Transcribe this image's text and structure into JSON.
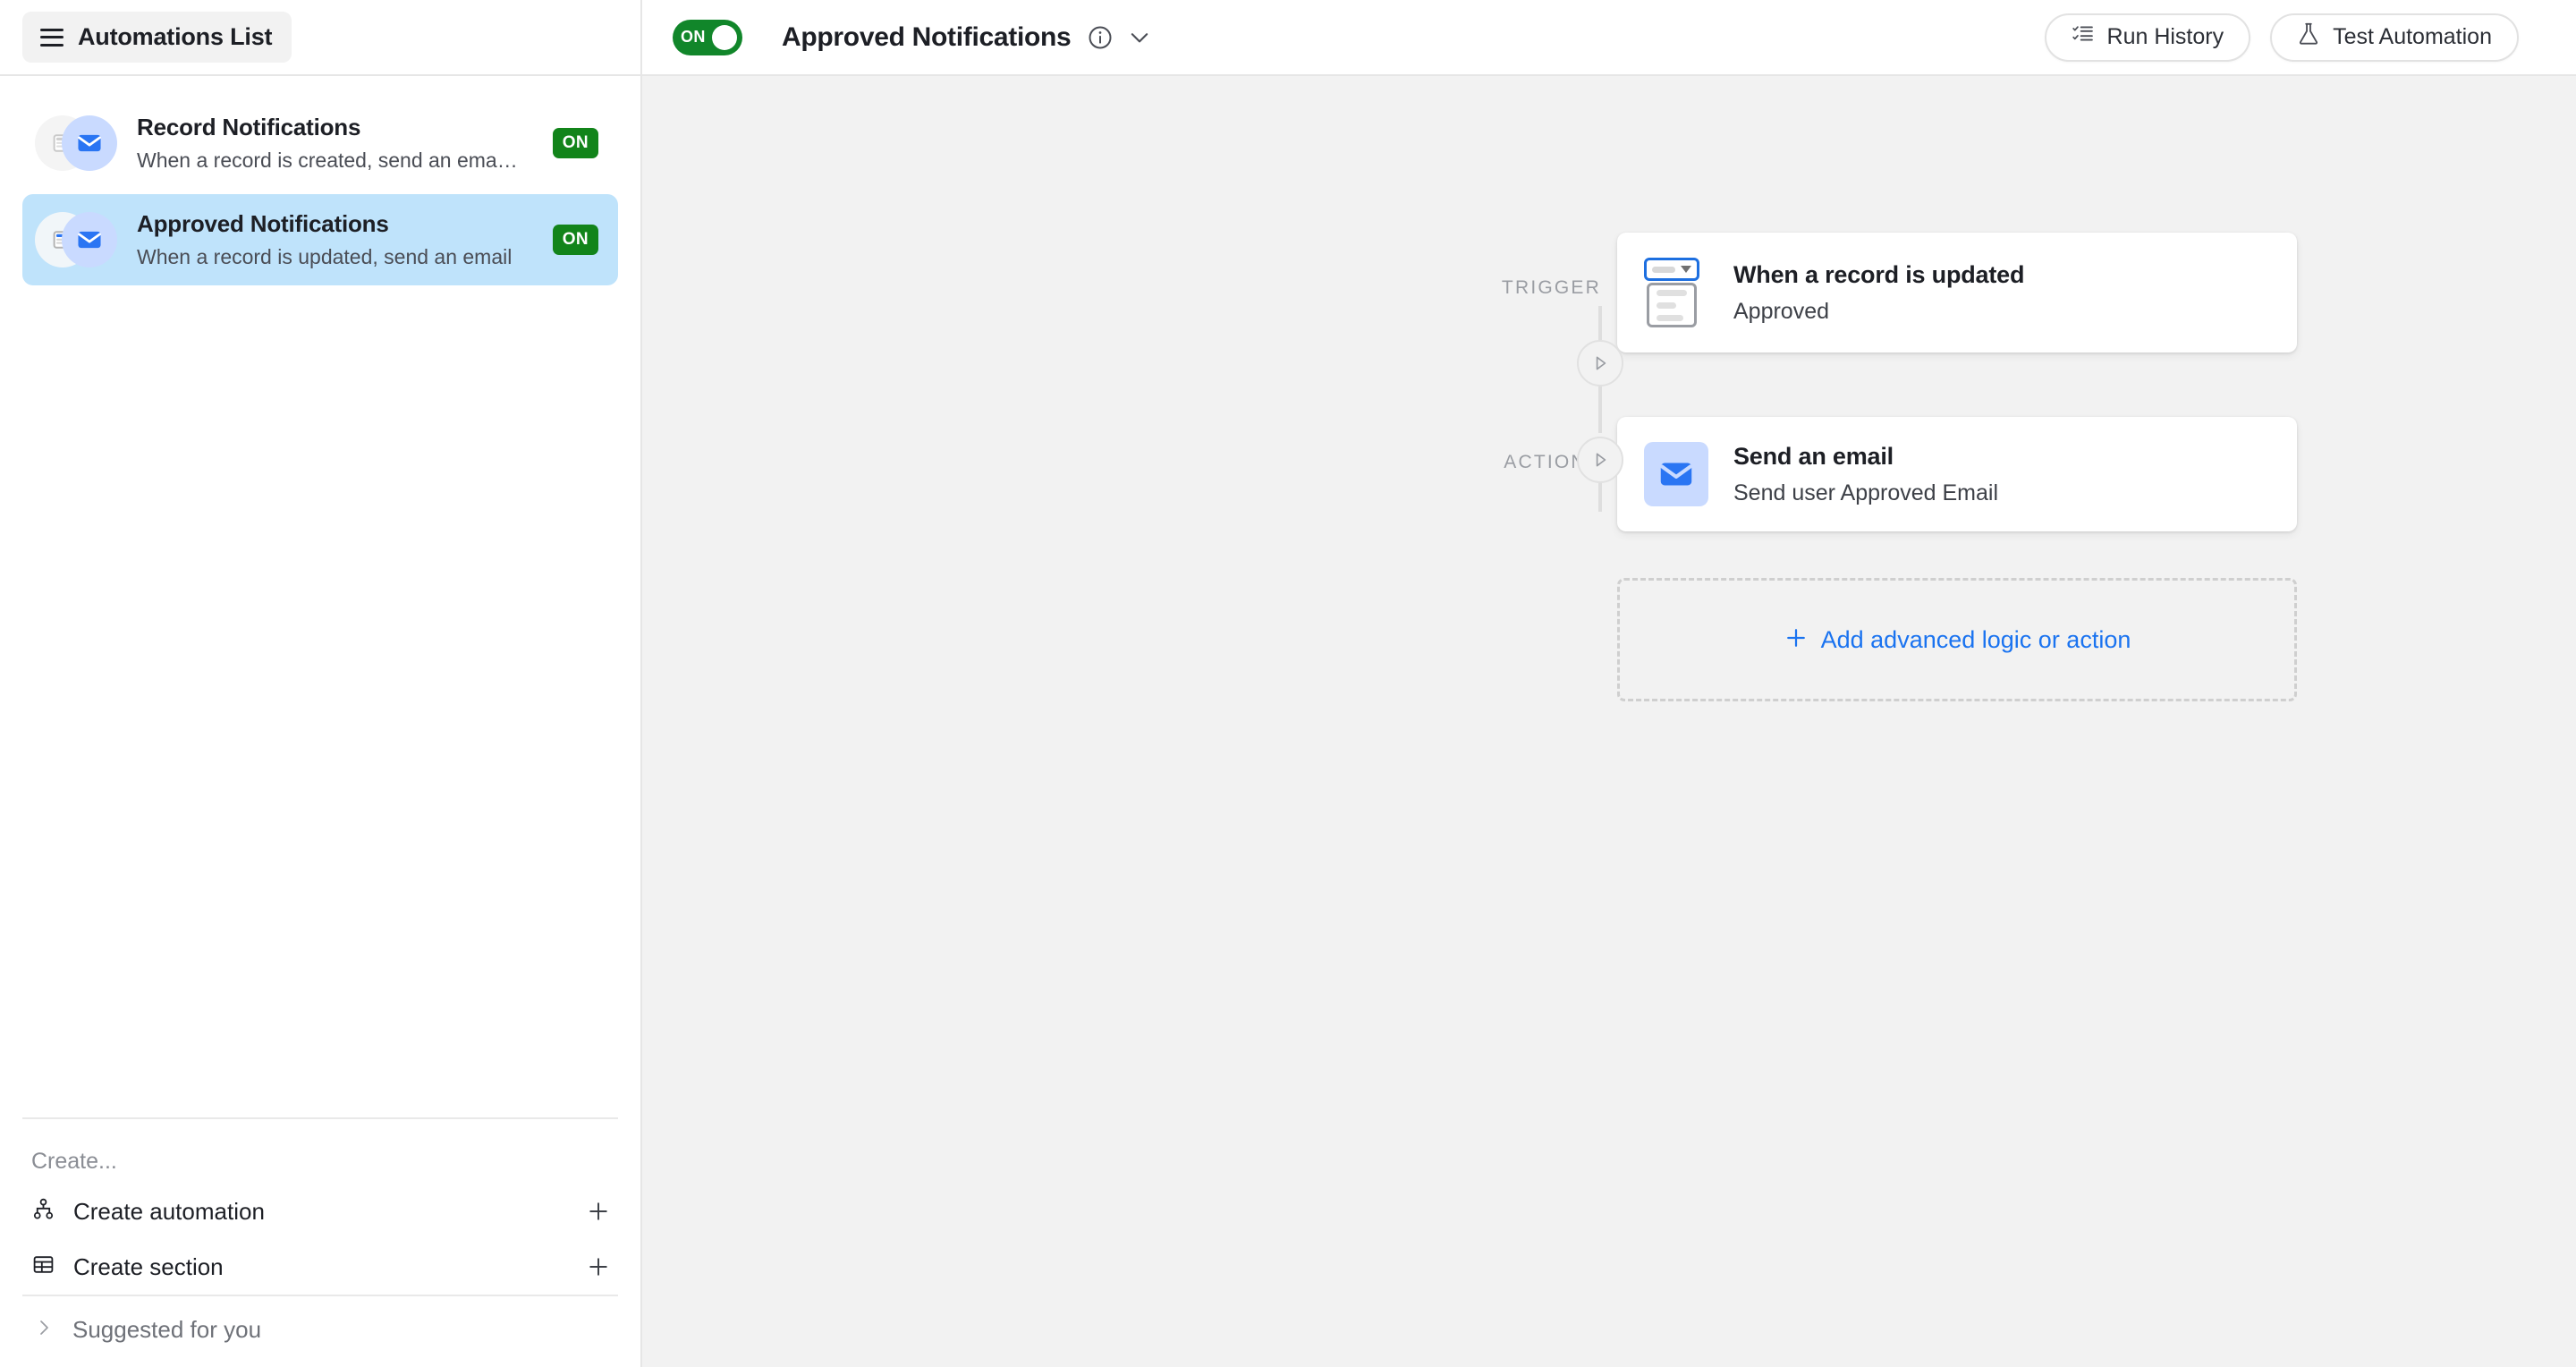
{
  "topbar": {
    "menu_button_label": "Automations List",
    "menu_icon": "hamburger-icon",
    "toggle": {
      "state_label": "ON",
      "on_color": "#11862a"
    },
    "automation_title": "Approved Notifications",
    "info_icon": "info-circle-icon",
    "chevron_icon": "chevron-down-icon",
    "run_history_label": "Run History",
    "run_history_icon": "checklist-icon",
    "test_automation_label": "Test Automation",
    "test_automation_icon": "flask-icon"
  },
  "sidebar": {
    "automations": [
      {
        "name": "Record Notifications",
        "description": "When a record is created, send an ema…",
        "status": "ON",
        "selected": false,
        "icons": [
          "record-icon",
          "email-icon"
        ]
      },
      {
        "name": "Approved Notifications",
        "description": "When a record is updated, send an email",
        "status": "ON",
        "selected": true,
        "icons": [
          "record-icon",
          "email-icon"
        ]
      }
    ],
    "create_section_label": "Create...",
    "create_rows": [
      {
        "label": "Create automation",
        "icon": "sitemap-icon",
        "action_icon": "plus-icon"
      },
      {
        "label": "Create section",
        "icon": "table-icon",
        "action_icon": "plus-icon"
      }
    ],
    "suggested_label": "Suggested for you",
    "suggested_icon": "chevron-right-icon"
  },
  "canvas": {
    "rail_labels": {
      "trigger": "TRIGGER",
      "actions": "ACTIONS"
    },
    "trigger_card": {
      "title": "When a record is updated",
      "subtitle": "Approved",
      "icon": "record-updated-icon",
      "play_icon": "play-icon"
    },
    "action_cards": [
      {
        "title": "Send an email",
        "subtitle": "Send user Approved Email",
        "icon": "email-icon",
        "play_icon": "play-icon"
      }
    ],
    "add_action": {
      "label": "Add advanced logic or action",
      "icon": "plus-icon",
      "color": "#1a73f0"
    }
  },
  "colors": {
    "canvas_bg": "#f2f2f2",
    "selected_row": "#bfe3fb",
    "accent_blue": "#1a73f0",
    "badge_green": "#12841a"
  }
}
